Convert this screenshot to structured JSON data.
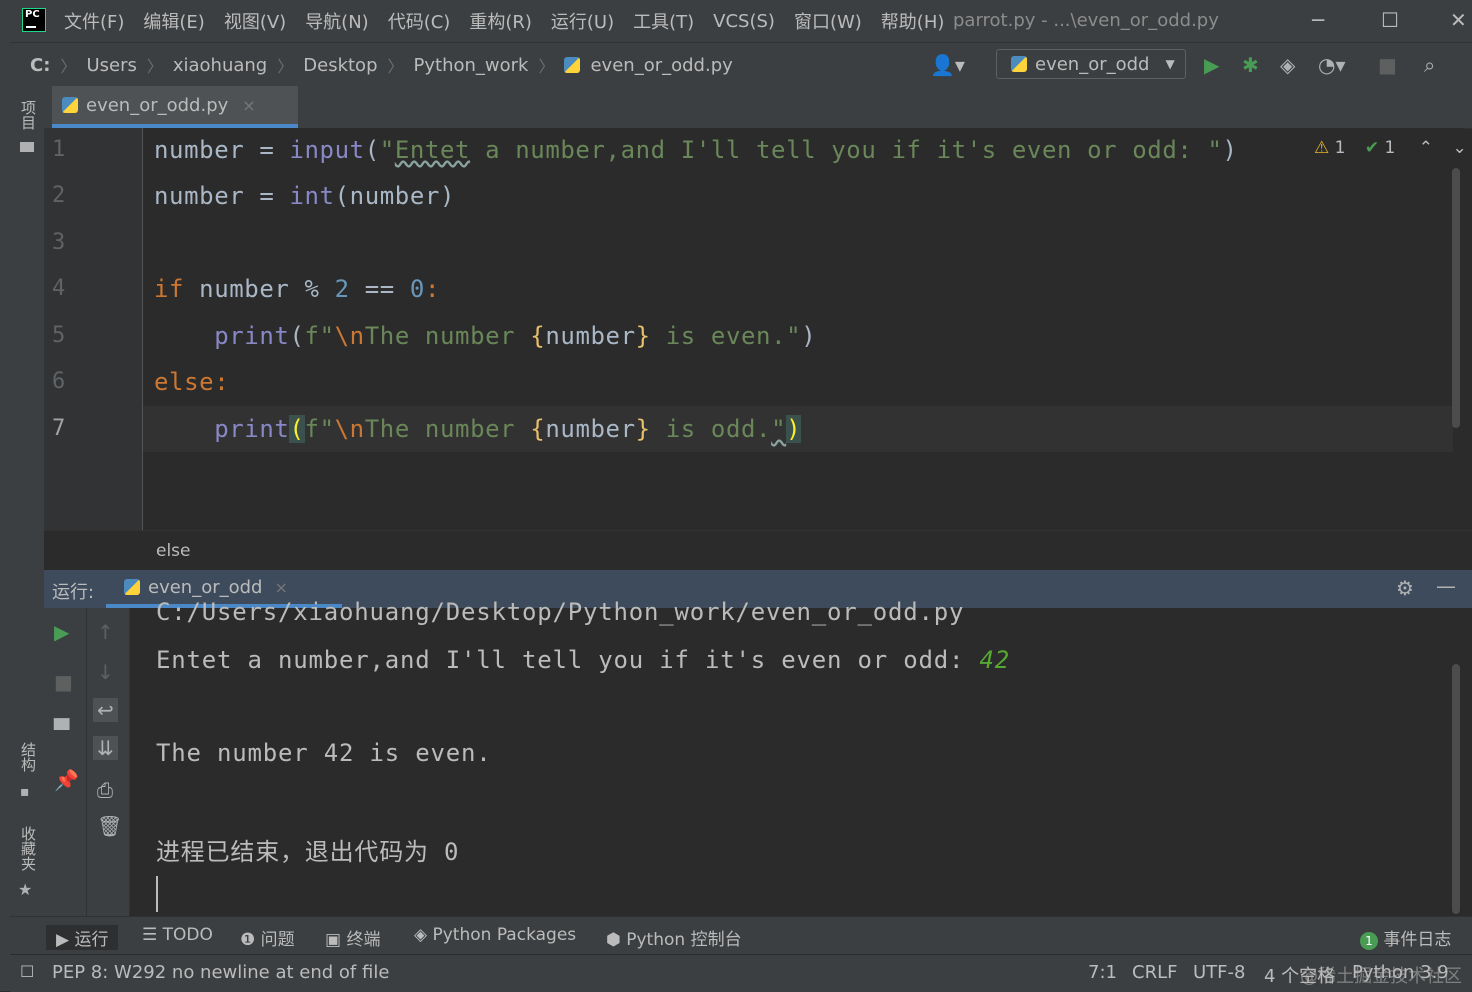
{
  "menubar": {
    "logo_text": "PC",
    "items": [
      "文件(F)",
      "编辑(E)",
      "视图(V)",
      "导航(N)",
      "代码(C)",
      "重构(R)",
      "运行(U)",
      "工具(T)",
      "VCS(S)",
      "窗口(W)",
      "帮助(H)"
    ],
    "window_title": "parrot.py - ...\\even_or_odd.py",
    "minimize": "─",
    "maximize": "☐",
    "close": "✕"
  },
  "navbar": {
    "drive": "C:",
    "crumbs": [
      "Users",
      "xiaohuang",
      "Desktop",
      "Python_work",
      "even_or_odd.py"
    ],
    "run_config": "even_or_odd"
  },
  "left_stripe": {
    "project": "项目",
    "structure": "结构",
    "favorites": "收藏夹"
  },
  "editor": {
    "tab_label": "even_or_odd.py",
    "tab_close": "×",
    "line_numbers": [
      "1",
      "2",
      "3",
      "4",
      "5",
      "6",
      "7"
    ],
    "inspection": {
      "warning_icon": "warning-triangle-icon",
      "warnings": "1",
      "ok_icon": "check-icon",
      "ok_count": "1"
    },
    "lines": {
      "l1": {
        "var": "number",
        "op": " = ",
        "fn": "input",
        "p1": "(",
        "s1": "\"",
        "wavy": "Entet",
        "s2": " a number,and I'll tell you if it's even or odd: \"",
        "p2": ")"
      },
      "l2": {
        "var": "number",
        "op": " = ",
        "fn": "int",
        "rest": "(number)"
      },
      "l4": {
        "kw": "if",
        "var": " number ",
        "op": "% ",
        "n1": "2",
        "eq": " == ",
        "n2": "0",
        "colon": ":"
      },
      "l5": {
        "fn": "print",
        "p1": "(",
        "pre": "f\"",
        "esc": "\\n",
        "s1": "The number ",
        "b1": "{",
        "var": "number",
        "b2": "}",
        "s2": " is even.\"",
        "p2": ")"
      },
      "l6": {
        "kw": "else",
        "colon": ":"
      },
      "l7": {
        "fn": "print",
        "p1": "(",
        "pre": "f\"",
        "esc": "\\n",
        "s1": "The number ",
        "b1": "{",
        "var": "number",
        "b2": "}",
        "s2": " is odd.",
        "s3": "\"",
        "p2": ")"
      }
    },
    "breadcrumb": "else"
  },
  "run_panel": {
    "label": "运行:",
    "tab": "even_or_odd",
    "tab_close": "×",
    "output": {
      "path": "C:/Users/xiaohuang/Desktop/Python_work/even_or_odd.py",
      "prompt": "Entet a number,and I'll tell you if it's even or odd: ",
      "input": "42",
      "result": "The number 42 is even.",
      "exit": "进程已结束，退出代码为 0"
    }
  },
  "bottom_tabs": {
    "run": "运行",
    "todo": "TODO",
    "problems": "问题",
    "terminal": "终端",
    "packages": "Python Packages",
    "console": "Python 控制台",
    "event_count": "1",
    "event_log": "事件日志"
  },
  "statusbar": {
    "message": "PEP 8: W292 no newline at end of file",
    "position": "7:1",
    "line_sep": "CRLF",
    "encoding": "UTF-8",
    "indent": "4 个空格",
    "interpreter": "Python 3.9"
  },
  "watermark": "@稀土掘金技术社区",
  "colors": {
    "keyword": "#cc7832",
    "builtin": "#8888c6",
    "string": "#6a8759",
    "number": "#6897bb",
    "run_green": "#499c54",
    "accent": "#4a88c7"
  }
}
